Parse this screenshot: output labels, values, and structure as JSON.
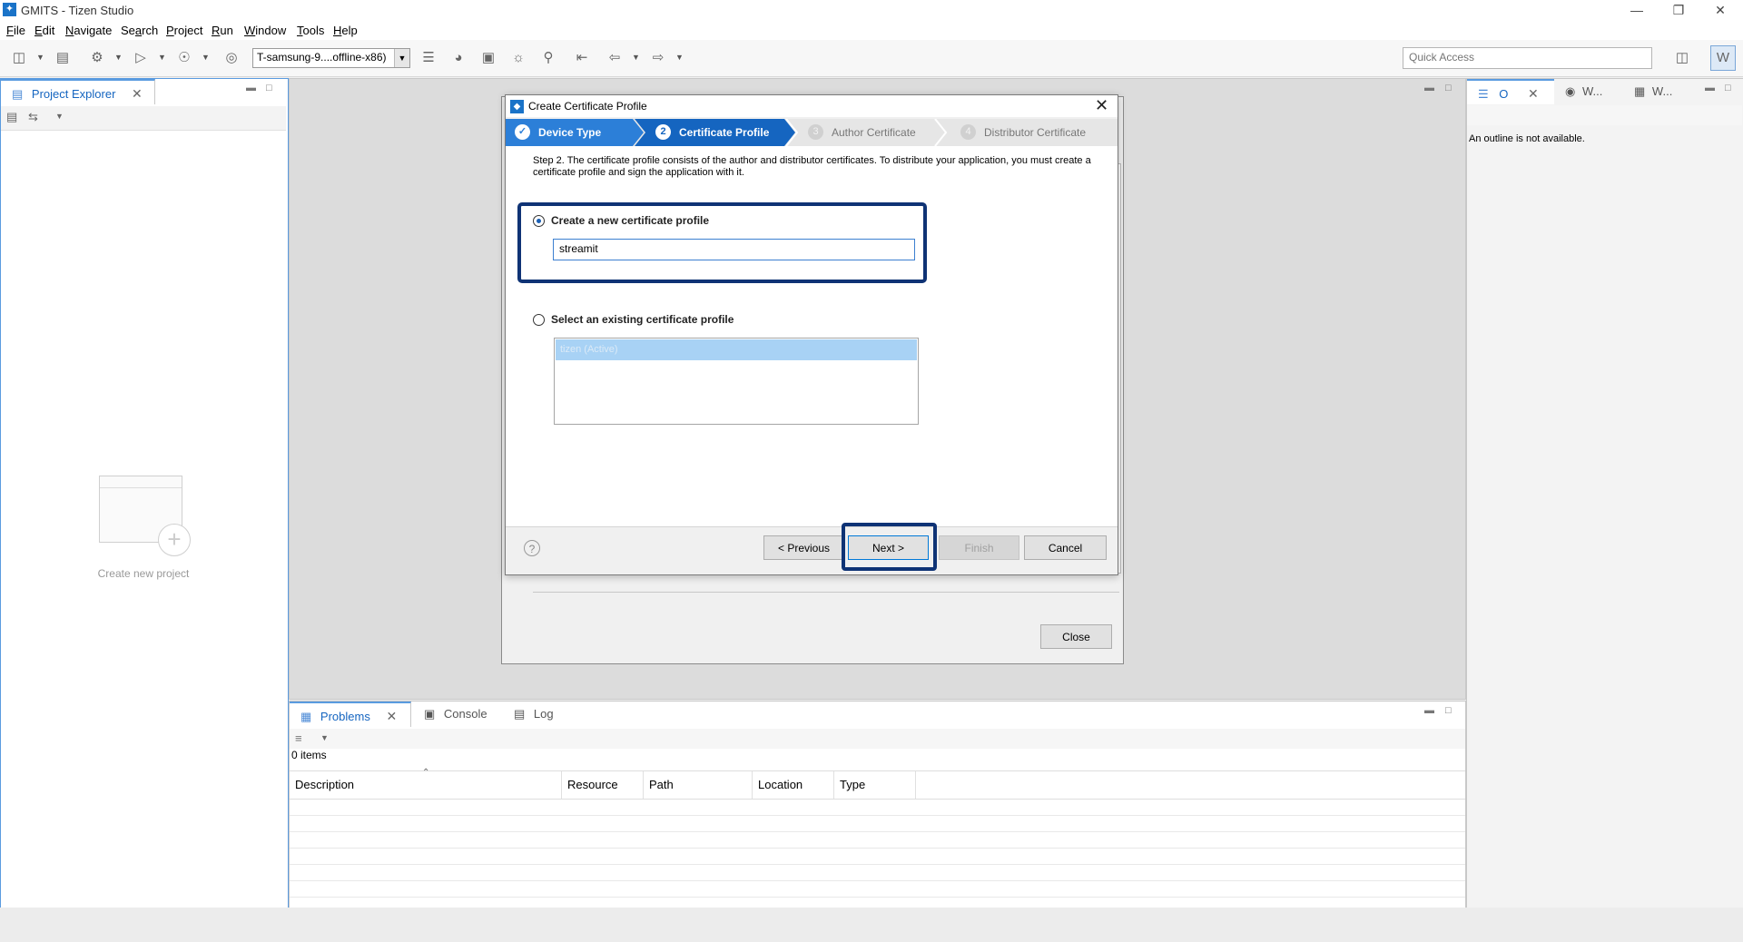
{
  "window": {
    "title": "GMITS - Tizen Studio"
  },
  "menu": [
    {
      "pre": "",
      "u": "F",
      "post": "ile"
    },
    {
      "pre": "",
      "u": "E",
      "post": "dit"
    },
    {
      "pre": "",
      "u": "N",
      "post": "avigate"
    },
    {
      "pre": "Se",
      "u": "a",
      "post": "rch"
    },
    {
      "pre": "",
      "u": "P",
      "post": "roject"
    },
    {
      "pre": "",
      "u": "R",
      "post": "un"
    },
    {
      "pre": "",
      "u": "W",
      "post": "indow"
    },
    {
      "pre": "",
      "u": "T",
      "post": "ools"
    },
    {
      "pre": "",
      "u": "H",
      "post": "elp"
    }
  ],
  "toolbar": {
    "device": "T-samsung-9....offline-x86)",
    "quick_access_placeholder": "Quick Access"
  },
  "project_explorer": {
    "tab": "Project Explorer",
    "create_new": "Create new project"
  },
  "outline": {
    "tab_outline": "O",
    "tab_w1": "W...",
    "tab_w2": "W...",
    "message": "An outline is not available."
  },
  "problems": {
    "tabs": [
      "Problems",
      "Console",
      "Log"
    ],
    "count": "0 items",
    "columns": [
      "Description",
      "Resource",
      "Path",
      "Location",
      "Type"
    ]
  },
  "outer_dialog": {
    "close_label": "Close"
  },
  "dialog": {
    "title": "Create Certificate Profile",
    "steps": [
      {
        "num": "✓",
        "label": "Device Type"
      },
      {
        "num": "2",
        "label": "Certificate Profile"
      },
      {
        "num": "3",
        "label": "Author Certificate"
      },
      {
        "num": "4",
        "label": "Distributor Certificate"
      }
    ],
    "description": "Step 2. The certificate profile consists of the author and distributor certificates. To distribute your application, you must create a certificate profile and sign the application with it.",
    "option_new": "Create a new certificate profile",
    "profile_name_value": "streamit",
    "option_existing": "Select an existing certificate profile",
    "existing_profiles": [
      "tizen (Active)"
    ],
    "buttons": {
      "previous": "< Previous",
      "next": "Next >",
      "finish": "Finish",
      "cancel": "Cancel"
    },
    "help": "?"
  },
  "colors": {
    "accent": "#1565c0",
    "highlight": "#0f3375",
    "step_active": "#2c7fd8"
  }
}
